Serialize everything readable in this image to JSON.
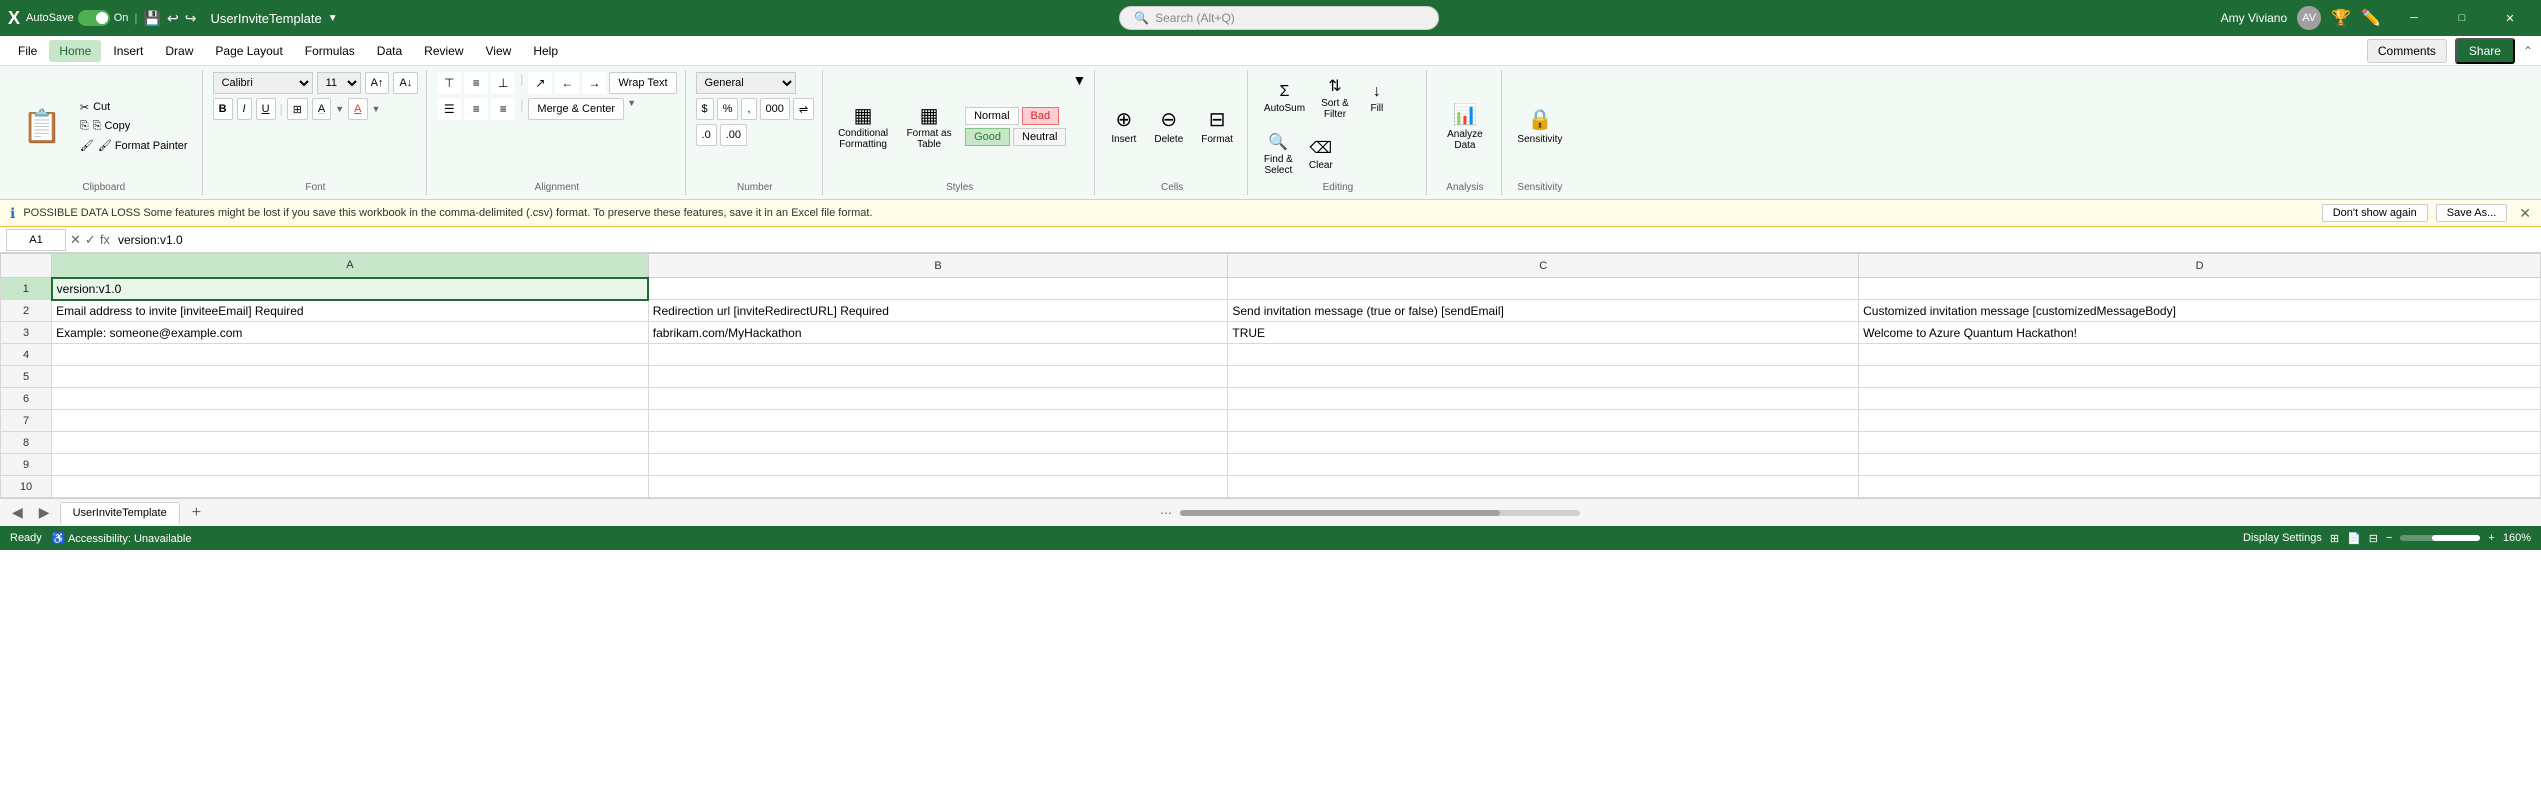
{
  "titleBar": {
    "autosave": "AutoSave",
    "autosave_state": "On",
    "file_name": "UserInviteTemplate",
    "search_placeholder": "Search (Alt+Q)",
    "user_name": "Amy Viviano",
    "minimize": "─",
    "maximize": "□",
    "close": "✕"
  },
  "menuBar": {
    "items": [
      "File",
      "Home",
      "Insert",
      "Draw",
      "Page Layout",
      "Formulas",
      "Data",
      "Review",
      "View",
      "Help"
    ],
    "active": "Home",
    "comments_label": "Comments",
    "share_label": "Share"
  },
  "ribbon": {
    "clipboard": {
      "label": "Clipboard",
      "paste": "📋",
      "paste_label": "Paste",
      "cut": "✂ Cut",
      "copy": "⎘ Copy",
      "format_painter": "🖌 Format Painter"
    },
    "font": {
      "label": "Font",
      "font_name": "Calibri",
      "font_size": "11",
      "bold": "B",
      "italic": "I",
      "underline": "U",
      "border": "⊞",
      "fill": "A",
      "color": "A"
    },
    "alignment": {
      "label": "Alignment",
      "wrap_text": "Wrap Text",
      "merge_center": "Merge & Center"
    },
    "number": {
      "label": "Number",
      "format": "General"
    },
    "styles": {
      "label": "Styles",
      "normal": "Normal",
      "bad": "Bad",
      "good": "Good",
      "neutral": "Neutral",
      "conditional_formatting": "Conditional\nFormatting",
      "format_as_table": "Format as\nTable"
    },
    "cells": {
      "label": "Cells",
      "insert": "Insert",
      "delete": "Delete",
      "format": "Format"
    },
    "editing": {
      "label": "Editing",
      "autosum": "AutoSum",
      "fill": "Fill",
      "clear": "Clear",
      "sort_filter": "Sort &\nFilter",
      "find_select": "Find &\nSelect"
    },
    "analysis": {
      "label": "Analysis",
      "analyze_data": "Analyze\nData"
    },
    "sensitivity": {
      "label": "Sensitivity",
      "sensitivity": "Sensitivity"
    }
  },
  "notificationBar": {
    "icon": "ℹ",
    "text": "POSSIBLE DATA LOSS  Some features might be lost if you save this workbook in the comma-delimited (.csv) format. To preserve these features, save it in an Excel file format.",
    "dont_show": "Don't show again",
    "save_as": "Save As...",
    "close": "✕"
  },
  "formulaBar": {
    "cell_ref": "A1",
    "formula": "version:v1.0"
  },
  "grid": {
    "columns": [
      "A",
      "B",
      "C",
      "D"
    ],
    "col_widths": [
      "350",
      "340",
      "370",
      "400"
    ],
    "rows": [
      {
        "num": 1,
        "cells": [
          "version:v1.0",
          "",
          "",
          ""
        ]
      },
      {
        "num": 2,
        "cells": [
          "Email address to invite [inviteeEmail] Required",
          "Redirection url [inviteRedirectURL] Required",
          "Send invitation message (true or false) [sendEmail]",
          "Customized invitation message [customizedMessageBody]"
        ]
      },
      {
        "num": 3,
        "cells": [
          "Example:    someone@example.com",
          "fabrikam.com/MyHackathon",
          "TRUE",
          "Welcome to Azure Quantum Hackathon!"
        ]
      },
      {
        "num": 4,
        "cells": [
          "",
          "",
          "",
          ""
        ]
      },
      {
        "num": 5,
        "cells": [
          "",
          "",
          "",
          ""
        ]
      },
      {
        "num": 6,
        "cells": [
          "",
          "",
          "",
          ""
        ]
      },
      {
        "num": 7,
        "cells": [
          "",
          "",
          "",
          ""
        ]
      },
      {
        "num": 8,
        "cells": [
          "",
          "",
          "",
          ""
        ]
      },
      {
        "num": 9,
        "cells": [
          "",
          "",
          "",
          ""
        ]
      },
      {
        "num": 10,
        "cells": [
          "",
          "",
          "",
          ""
        ]
      }
    ]
  },
  "sheetTabs": {
    "active_tab": "UserInviteTemplate",
    "tabs": [
      "UserInviteTemplate"
    ],
    "add_label": "+"
  },
  "statusBar": {
    "ready": "Ready",
    "accessibility": "Accessibility: Unavailable",
    "display_settings": "Display Settings",
    "zoom": "160%"
  }
}
